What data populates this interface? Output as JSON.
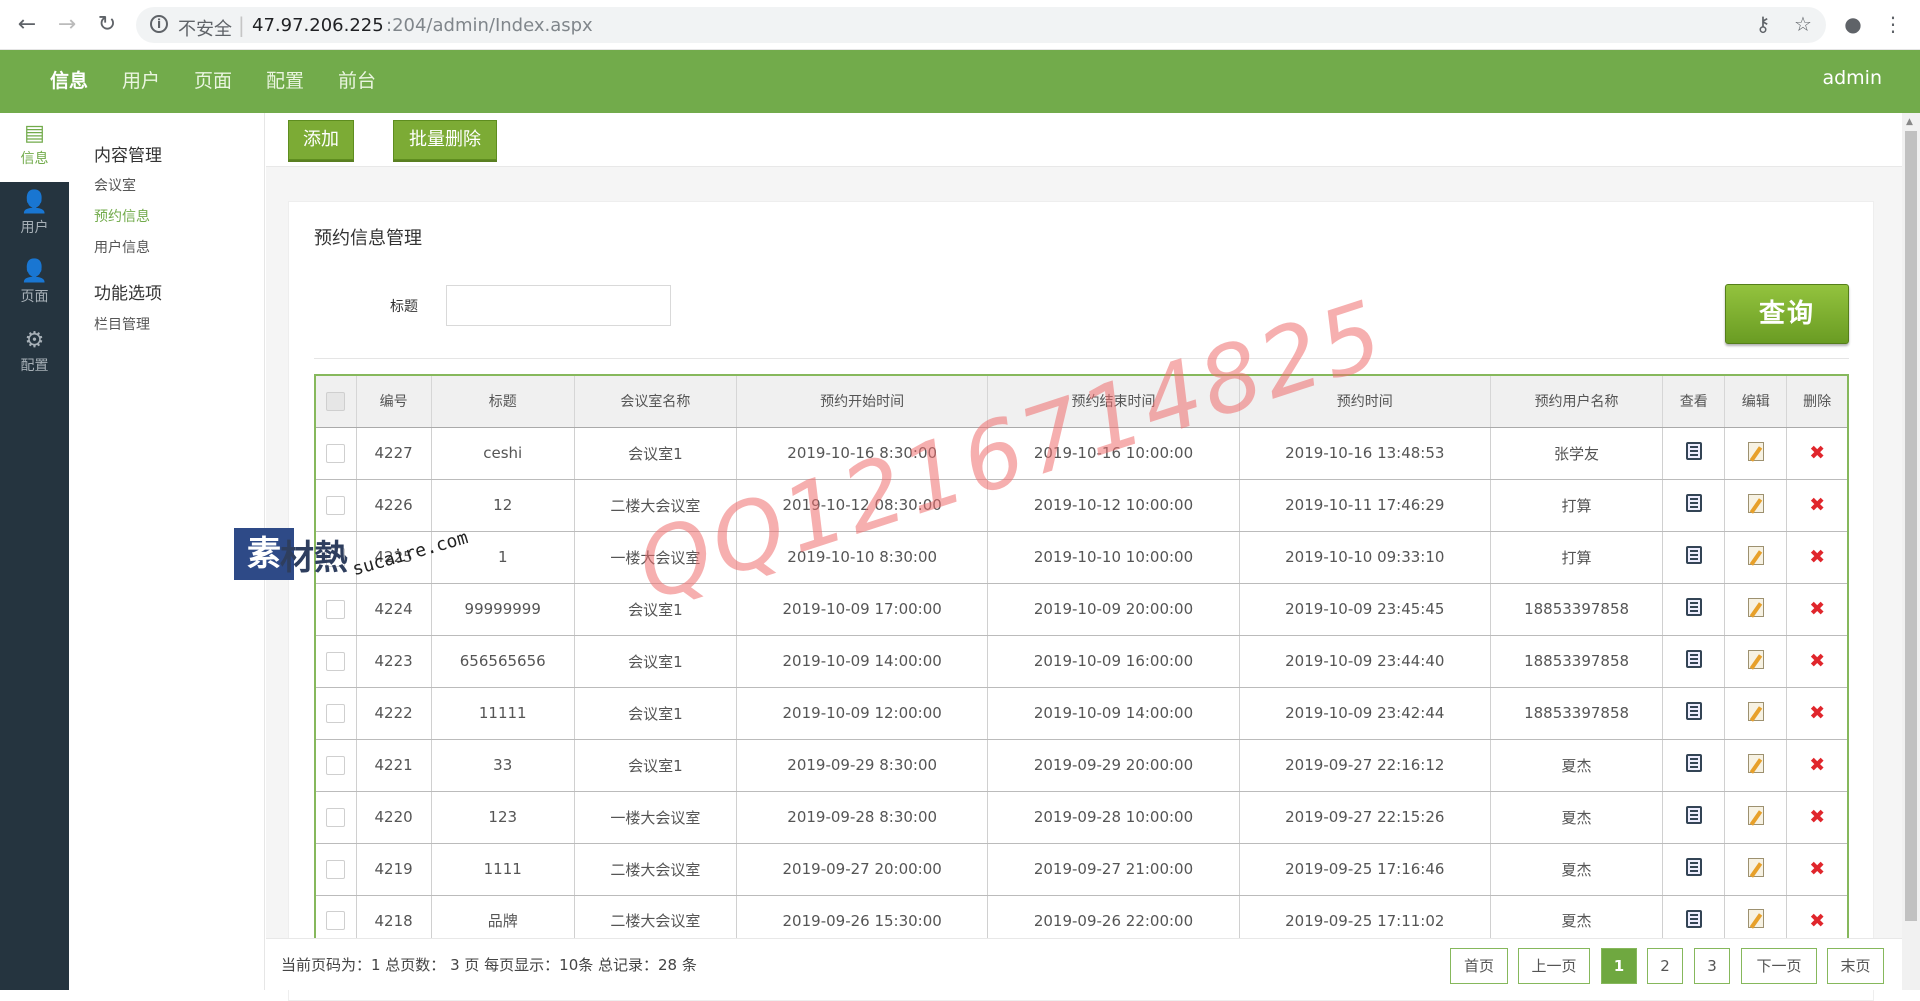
{
  "browser": {
    "insecure_label": "不安全",
    "url_host": "47.97.206.225",
    "url_path": ":204/admin/Index.aspx"
  },
  "topnav": {
    "items": [
      "信息",
      "用户",
      "页面",
      "配置",
      "前台"
    ],
    "user": "admin"
  },
  "iconbar": {
    "items": [
      {
        "label": "信息",
        "icon": "document-icon"
      },
      {
        "label": "用户",
        "icon": "user-icon"
      },
      {
        "label": "页面",
        "icon": "user-list-icon"
      },
      {
        "label": "配置",
        "icon": "gear-icon"
      }
    ]
  },
  "subnav": {
    "group1": "内容管理",
    "group1_links": [
      "会议室",
      "预约信息",
      "用户信息"
    ],
    "group2": "功能选项",
    "group2_links": [
      "栏目管理"
    ]
  },
  "toolbar": {
    "add_label": "添加",
    "batch_delete_label": "批量删除"
  },
  "panel": {
    "title": "预约信息管理",
    "filter_label": "标题",
    "filter_value": "",
    "query_label": "查询"
  },
  "table": {
    "headers": [
      "编号",
      "标题",
      "会议室名称",
      "预约开始时间",
      "预约结束时间",
      "预约时间",
      "预约用户名称",
      "查看",
      "编辑",
      "删除"
    ],
    "rows": [
      [
        "4227",
        "ceshi",
        "会议室1",
        "2019-10-16 8:30:00",
        "2019-10-16 10:00:00",
        "2019-10-16 13:48:53",
        "张学友"
      ],
      [
        "4226",
        "12",
        "二楼大会议室",
        "2019-10-12 08:30:00",
        "2019-10-12 10:00:00",
        "2019-10-11 17:46:29",
        "打算"
      ],
      [
        "4225",
        "1",
        "一楼大会议室",
        "2019-10-10 8:30:00",
        "2019-10-10 10:00:00",
        "2019-10-10 09:33:10",
        "打算"
      ],
      [
        "4224",
        "99999999",
        "会议室1",
        "2019-10-09 17:00:00",
        "2019-10-09 20:00:00",
        "2019-10-09 23:45:45",
        "18853397858"
      ],
      [
        "4223",
        "656565656",
        "会议室1",
        "2019-10-09 14:00:00",
        "2019-10-09 16:00:00",
        "2019-10-09 23:44:40",
        "18853397858"
      ],
      [
        "4222",
        "11111",
        "会议室1",
        "2019-10-09 12:00:00",
        "2019-10-09 14:00:00",
        "2019-10-09 23:42:44",
        "18853397858"
      ],
      [
        "4221",
        "33",
        "会议室1",
        "2019-09-29 8:30:00",
        "2019-09-29 20:00:00",
        "2019-09-27 22:16:12",
        "夏杰"
      ],
      [
        "4220",
        "123",
        "一楼大会议室",
        "2019-09-28 8:30:00",
        "2019-09-28 10:00:00",
        "2019-09-27 22:15:26",
        "夏杰"
      ],
      [
        "4219",
        "1111",
        "二楼大会议室",
        "2019-09-27 20:00:00",
        "2019-09-27 21:00:00",
        "2019-09-25 17:16:46",
        "夏杰"
      ],
      [
        "4218",
        "品牌",
        "二楼大会议室",
        "2019-09-26 15:30:00",
        "2019-09-26 22:00:00",
        "2019-09-25 17:11:02",
        "夏杰"
      ]
    ]
  },
  "pagination": {
    "summary": "当前页码为：1 总页数： 3 页 每页显示：10条 总记录：28 条",
    "first": "首页",
    "prev": "上一页",
    "pages": [
      "1",
      "2",
      "3"
    ],
    "current": "1",
    "next": "下一页",
    "last": "末页"
  },
  "watermark": {
    "text": "QQ1216714825",
    "logo": "素材熱",
    "url": "sucaire.com"
  },
  "colors": {
    "nav_green": "#72ab4b",
    "sidebar_dark": "#25343f",
    "button_green": "#7cab35",
    "delete_red": "#e0262c"
  }
}
